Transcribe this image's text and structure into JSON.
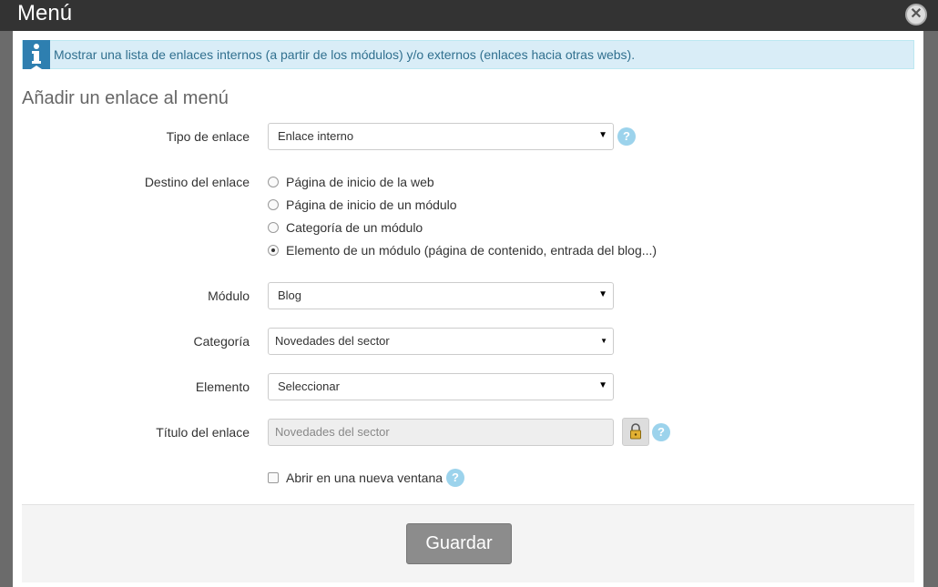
{
  "modal": {
    "title": "Menú",
    "info": "Mostrar una lista de enlaces internos (a partir de los módulos) y/o externos (enlaces hacia otras webs).",
    "section_title": "Añadir un enlace al menú"
  },
  "form": {
    "link_type": {
      "label": "Tipo de enlace",
      "value": "Enlace interno"
    },
    "destination": {
      "label": "Destino del enlace",
      "options": [
        {
          "label": "Página de inicio de la web",
          "selected": false
        },
        {
          "label": "Página de inicio de un módulo",
          "selected": false
        },
        {
          "label": "Categoría de un módulo",
          "selected": false
        },
        {
          "label": "Elemento de un módulo (página de contenido, entrada del blog...)",
          "selected": true
        }
      ]
    },
    "module": {
      "label": "Módulo",
      "value": "Blog"
    },
    "category": {
      "label": "Categoría",
      "value": "Novedades del sector"
    },
    "element": {
      "label": "Elemento",
      "value": "Seleccionar"
    },
    "link_title": {
      "label": "Título del enlace",
      "value": "Novedades del sector"
    },
    "new_window": {
      "label": "Abrir en una nueva ventana",
      "checked": false
    },
    "help_glyph": "?"
  },
  "footer": {
    "save_label": "Guardar"
  },
  "colors": {
    "info_bg": "#d9edf7",
    "info_icon": "#2e7fb0",
    "help": "#9cd3ec",
    "save": "#8c8c8c"
  },
  "icons": {
    "close": "close-icon",
    "info": "info-icon",
    "lock": "lock-icon",
    "help": "help-icon",
    "dropdown": "chevron-down-icon"
  }
}
